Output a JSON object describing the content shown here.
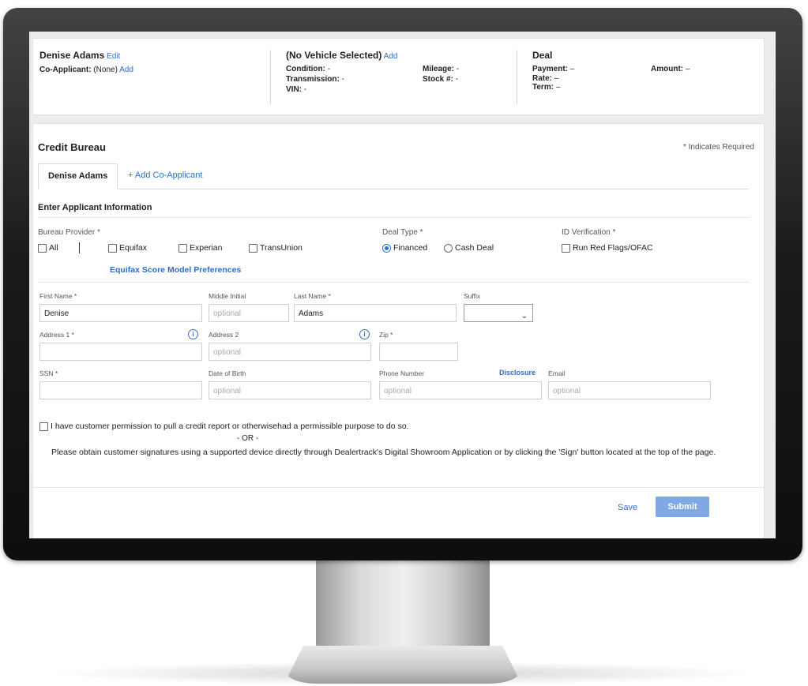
{
  "summary": {
    "customer": {
      "name": "Denise Adams",
      "edit_label": "Edit",
      "coapplicant_label": "Co-Applicant:",
      "coapplicant_value": "(None)",
      "add_label": "Add"
    },
    "vehicle": {
      "title": "(No Vehicle Selected)",
      "add_label": "Add",
      "condition_label": "Condition:",
      "condition_value": "-",
      "transmission_label": "Transmission:",
      "transmission_value": "-",
      "vin_label": "VIN:",
      "vin_value": "-",
      "mileage_label": "Mileage:",
      "mileage_value": "-",
      "stock_label": "Stock #:",
      "stock_value": "-"
    },
    "deal": {
      "title": "Deal",
      "payment_label": "Payment:",
      "payment_value": "–",
      "rate_label": "Rate:",
      "rate_value": "–",
      "term_label": "Term:",
      "term_value": "–",
      "amount_label": "Amount:",
      "amount_value": "–"
    }
  },
  "form": {
    "title": "Credit Bureau",
    "required_note": "* Indicates Required",
    "tabs": {
      "active": "Denise Adams",
      "add": "+ Add Co-Applicant"
    },
    "section_title": "Enter Applicant Information",
    "bureau": {
      "label": "Bureau Provider *",
      "all": "All",
      "equifax": "Equifax",
      "experian": "Experian",
      "transunion": "TransUnion",
      "preferences_link": "Equifax Score Model Preferences"
    },
    "deal_type": {
      "label": "Deal Type *",
      "financed": "Financed",
      "cash": "Cash Deal"
    },
    "id_verification": {
      "label": "ID Verification *",
      "option": "Run Red Flags/OFAC"
    },
    "fields": {
      "first_name": {
        "label": "First Name *",
        "value": "Denise"
      },
      "middle_initial": {
        "label": "Middle Initial",
        "placeholder": "optional"
      },
      "last_name": {
        "label": "Last Name *",
        "value": "Adams"
      },
      "suffix": {
        "label": "Suffix",
        "value": ""
      },
      "address1": {
        "label": "Address 1 *",
        "value": ""
      },
      "address2": {
        "label": "Address 2",
        "placeholder": "optional"
      },
      "zip": {
        "label": "Zip *",
        "value": ""
      },
      "ssn": {
        "label": "SSN *",
        "value": ""
      },
      "dob": {
        "label": "Date of Birth",
        "placeholder": "optional"
      },
      "phone": {
        "label": "Phone Number",
        "placeholder": "optional",
        "disclosure": "Disclosure"
      },
      "email": {
        "label": "Email",
        "placeholder": "optional"
      }
    },
    "permission": {
      "checkbox_text": "I have customer permission to pull a credit report or otherwisehad a permissible purpose to do so.",
      "or_text": "- OR -",
      "instructions": "Please obtain customer signatures using a supported device directly through Dealertrack's Digital Showroom Application or by clicking the 'Sign' button located at the top of the page."
    },
    "actions": {
      "save": "Save",
      "submit": "Submit"
    }
  }
}
